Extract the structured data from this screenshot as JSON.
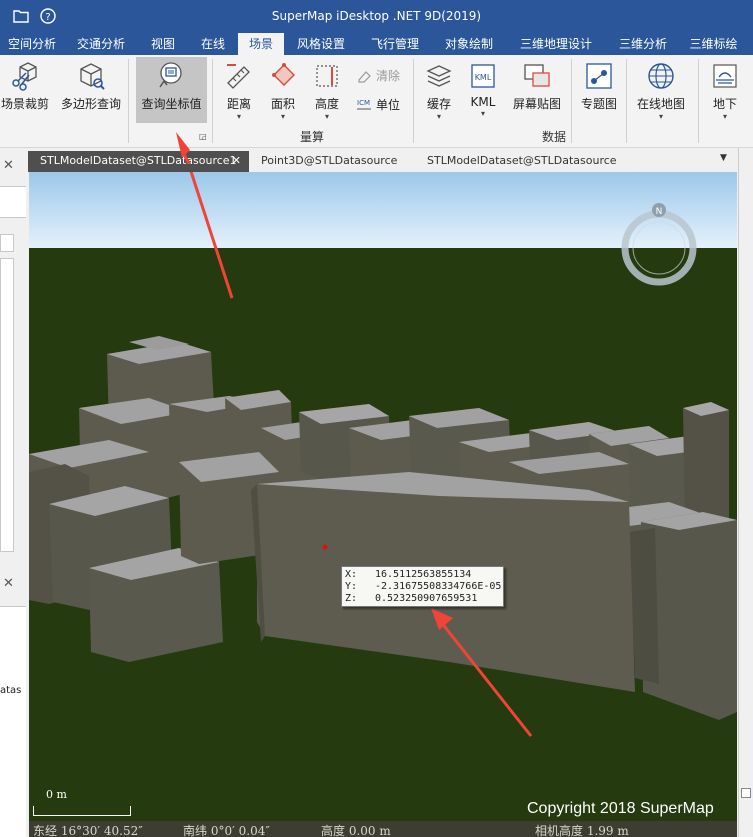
{
  "app": {
    "title": "SuperMap iDesktop .NET 9D(2019)"
  },
  "ribbon_tabs": [
    "空间分析",
    "交通分析",
    "视图",
    "在线",
    "场景",
    "风格设置",
    "飞行管理",
    "对象绘制",
    "三维地理设计",
    "三维分析",
    "三维标绘"
  ],
  "active_tab": "场景",
  "ribbon": {
    "scene_clip": "场景裁剪",
    "polygon_query": "多边形查询",
    "query_coord": "查询坐标值",
    "distance": "距离",
    "area": "面积",
    "height": "高度",
    "clear": "清除",
    "unit": "单位",
    "group_measure": "量算",
    "cache": "缓存",
    "kml": "KML",
    "screen_paste": "屏幕贴图",
    "thematic": "专题图",
    "online_map": "在线地图",
    "group_data": "数据",
    "underground": "地下"
  },
  "doc_tabs": [
    "STLModelDataset@STLDatasource1",
    "Point3D@STLDatasource",
    "STLModelDataset@STLDatasource"
  ],
  "left_panel": {
    "partial_text": "atas"
  },
  "compass": {
    "north_label": "N"
  },
  "coord_tooltip": {
    "x_label": "X:",
    "x_value": "16.5112563855134",
    "y_label": "Y:",
    "y_value": "-2.31675508334766E-05",
    "z_label": "Z:",
    "z_value": "0.523250907659531"
  },
  "scale": {
    "label": "0 m"
  },
  "copyright": "Copyright 2018 SuperMap",
  "status": {
    "longitude": "东经 16°30′ 40.52″",
    "latitude": "南纬 0°0′ 0.04″",
    "height": "高度 0.00 m",
    "camera_height": "相机高度 1.99 m"
  },
  "colors": {
    "accent": "#2b579a",
    "ground": "#253a0f",
    "sky_top": "#9cc8ea",
    "sky_bottom": "#e4f1fb",
    "building_side": "#5d5b4e",
    "building_roof": "#a2a2a2",
    "arrow": "#ef4438"
  }
}
